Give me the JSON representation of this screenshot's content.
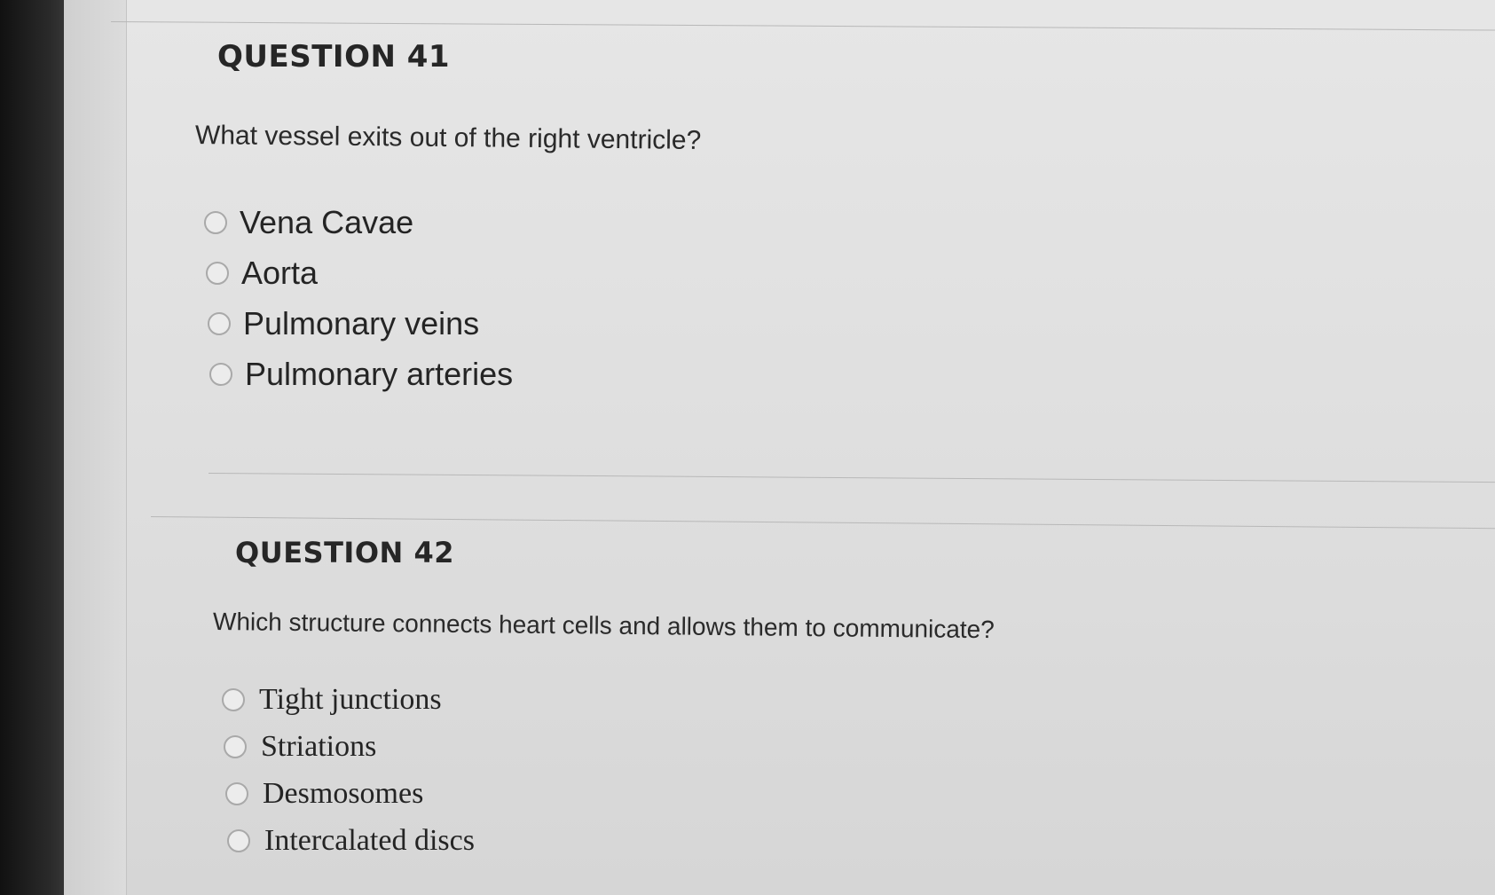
{
  "question_41": {
    "title": "QUESTION 41",
    "text": "What vessel exits out of the right ventricle?",
    "options": [
      {
        "label": "Vena Cavae"
      },
      {
        "label": "Aorta"
      },
      {
        "label": "Pulmonary veins"
      },
      {
        "label": "Pulmonary arteries"
      }
    ]
  },
  "question_42": {
    "title": "QUESTION 42",
    "text": "Which structure connects heart cells and allows them to communicate?",
    "options": [
      {
        "label": "Tight junctions"
      },
      {
        "label": "Striations"
      },
      {
        "label": "Desmosomes"
      },
      {
        "label": "Intercalated discs"
      }
    ]
  }
}
